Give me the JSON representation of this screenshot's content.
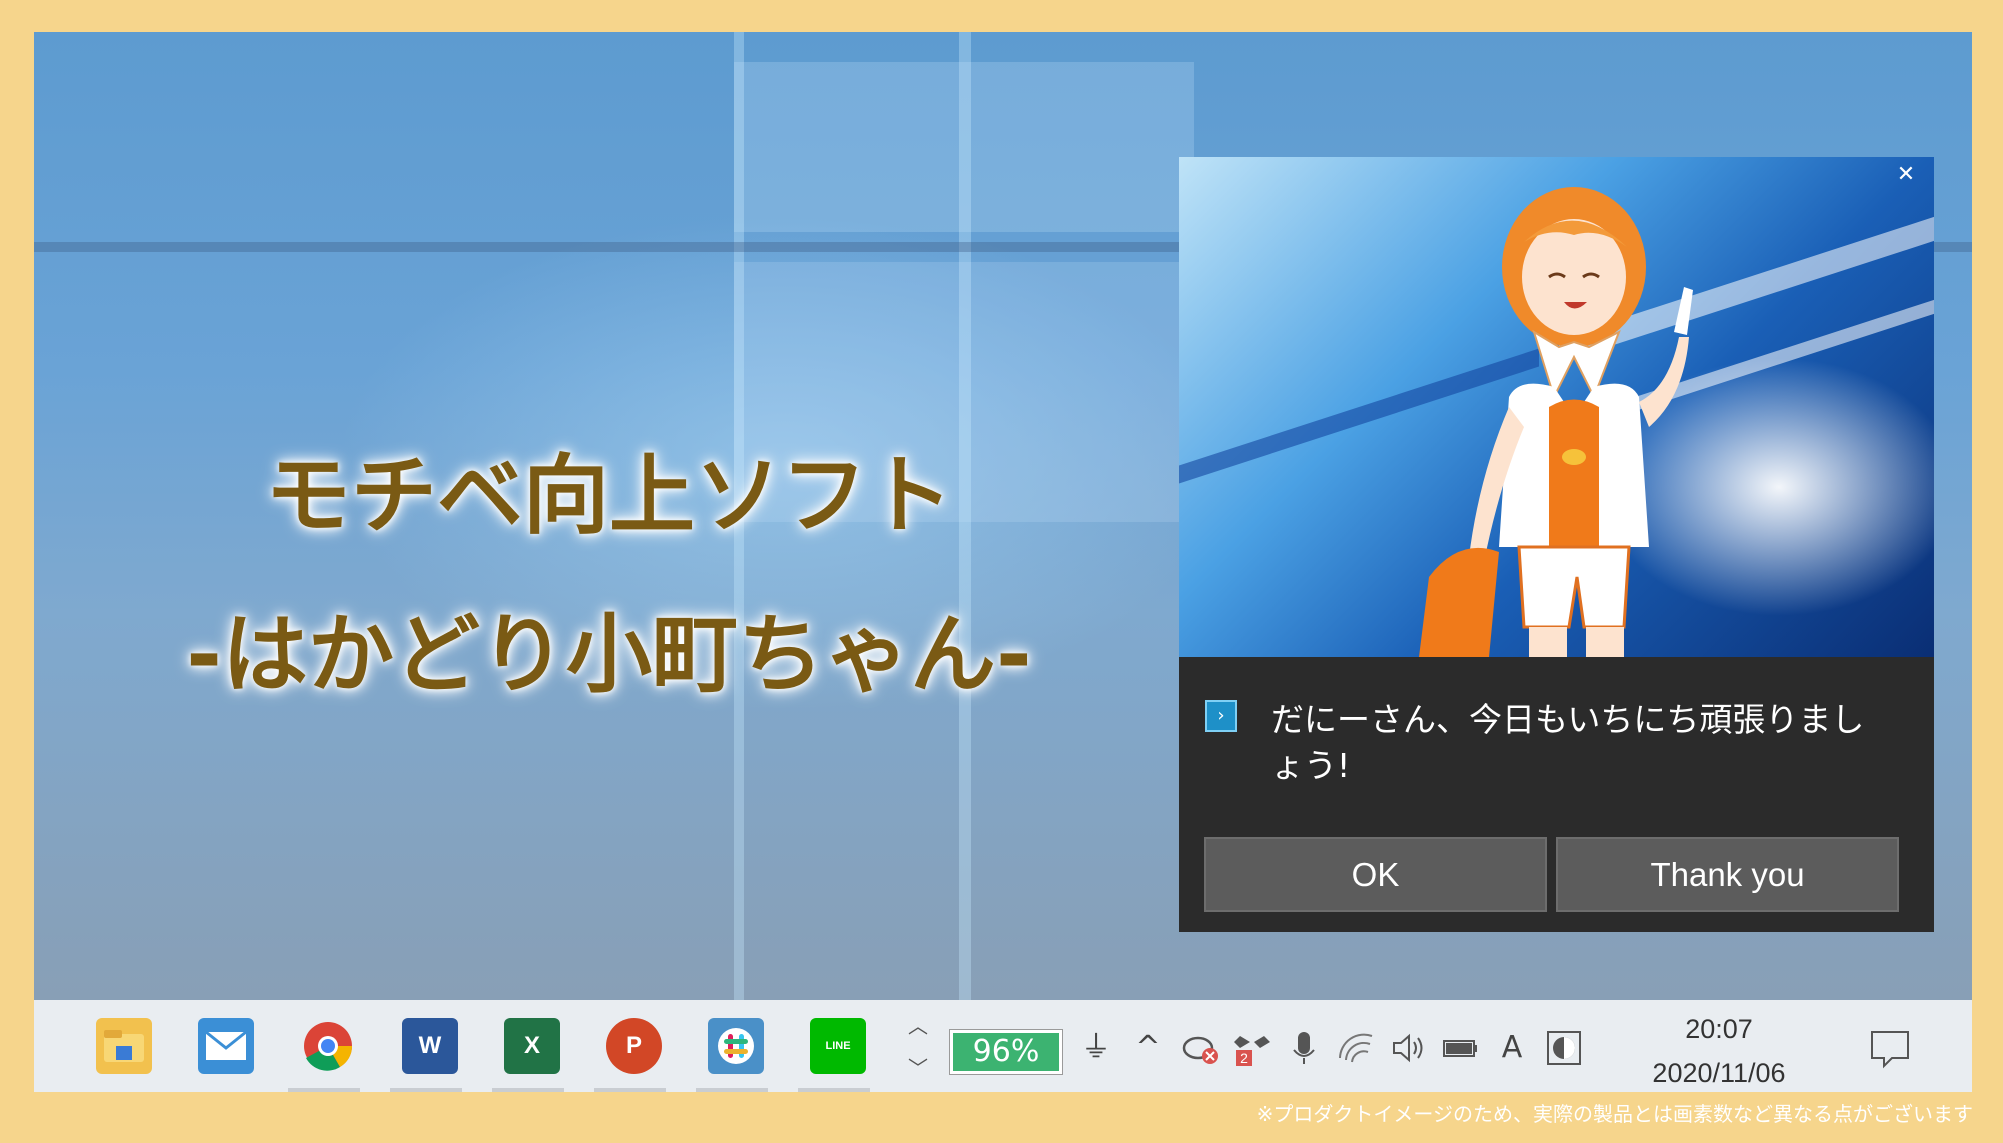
{
  "promo": {
    "title_line1": "モチベ向上ソフト",
    "title_line2": "-はかどり小町ちゃん-"
  },
  "toast": {
    "message": "だにーさん、今日もいちにち頑張りましょう!",
    "buttons": [
      {
        "label": "OK"
      },
      {
        "label": "Thank you"
      }
    ],
    "close_glyph": "✕",
    "app_icon": "powershell-icon"
  },
  "taskbar": {
    "pinned_apps": [
      {
        "name": "file-explorer-icon",
        "letter": ""
      },
      {
        "name": "mail-icon",
        "letter": ""
      },
      {
        "name": "chrome-icon",
        "letter": ""
      },
      {
        "name": "word-icon",
        "letter": "W"
      },
      {
        "name": "excel-icon",
        "letter": "X"
      },
      {
        "name": "powerpoint-icon",
        "letter": "P"
      },
      {
        "name": "slack-icon",
        "letter": ""
      },
      {
        "name": "line-icon",
        "letter": "LINE"
      }
    ],
    "battery_percent": "96%",
    "tray_icons": [
      "power-plug-icon",
      "show-hidden-icons-chevron",
      "onedrive-error-icon",
      "dropbox-icon",
      "microphone-icon",
      "wifi-icon",
      "volume-icon",
      "battery-status-icon",
      "ime-icon",
      "app-tray-icon"
    ],
    "dropbox_badge": "2",
    "clock": {
      "time": "20:07",
      "date": "2020/11/06"
    },
    "notification_center": "action-center-icon"
  },
  "footer_note": "※プロダクトイメージのため、実際の製品とは画素数など異なる点がございます",
  "colors": {
    "frame": "#f6d58c",
    "title_text": "#7a5a14",
    "toast_bg": "#2b2b2b",
    "toast_button": "#5c5c5c",
    "battery": "#3cb371"
  }
}
